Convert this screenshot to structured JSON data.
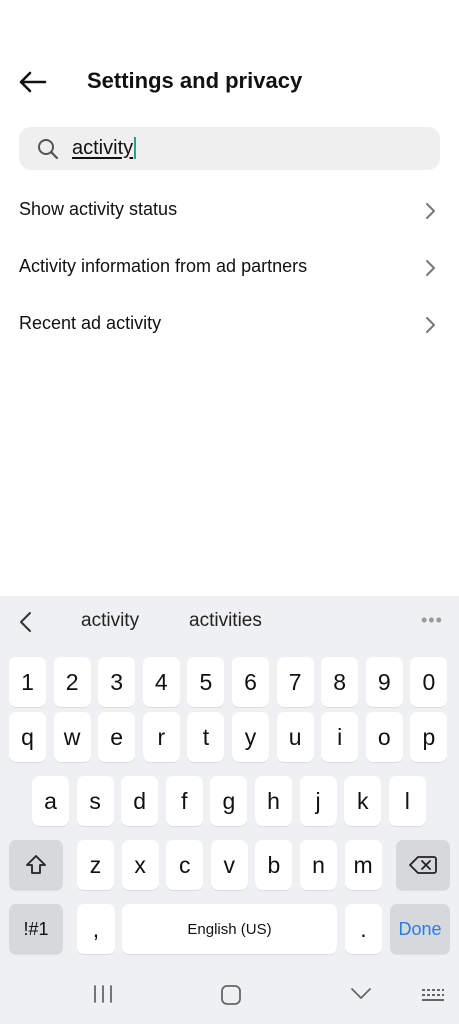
{
  "header": {
    "title": "Settings and privacy"
  },
  "search": {
    "value": "activity"
  },
  "results": [
    {
      "label": "Show activity status"
    },
    {
      "label": "Activity information from ad partners"
    },
    {
      "label": "Recent ad activity"
    }
  ],
  "keyboard": {
    "suggestions": [
      "activity",
      "activities"
    ],
    "more": "•••",
    "row_numbers": [
      "1",
      "2",
      "3",
      "4",
      "5",
      "6",
      "7",
      "8",
      "9",
      "0"
    ],
    "row_top": [
      "q",
      "w",
      "e",
      "r",
      "t",
      "y",
      "u",
      "i",
      "o",
      "p"
    ],
    "row_middle": [
      "a",
      "s",
      "d",
      "f",
      "g",
      "h",
      "j",
      "k",
      "l"
    ],
    "row_bottom": [
      "z",
      "x",
      "c",
      "v",
      "b",
      "n",
      "m"
    ],
    "symbols_label": "!#1",
    "comma_label": ",",
    "space_label": "English (US)",
    "period_label": ".",
    "done_label": "Done"
  },
  "colors": {
    "accent": "#1fa58f",
    "done": "#2a7de1"
  }
}
